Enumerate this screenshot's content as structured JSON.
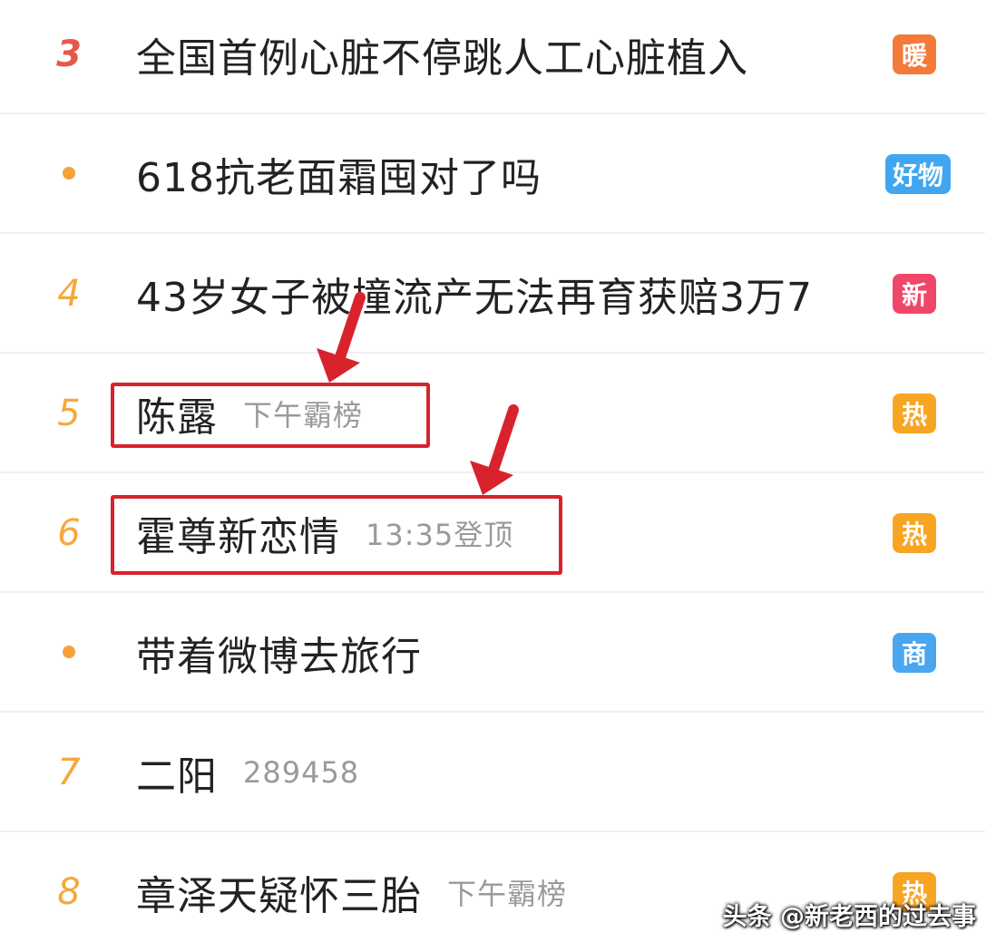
{
  "colors": {
    "warm": "#f47a3a",
    "goods": "#41a6f0",
    "new": "#f0466a",
    "hot": "#f8a524",
    "shop": "#4aa6ef",
    "highlight": "#d9232c",
    "rank_top": "#e8584a",
    "rank": "#f4a93c"
  },
  "rows": [
    {
      "rank": "3",
      "marker": "number-top",
      "title": "全国首例心脏不停跳人工心脏植入",
      "sub": "",
      "badge": "暖",
      "badge_type": "warm"
    },
    {
      "rank": "",
      "marker": "dot",
      "title": "618抗老面霜囤对了吗",
      "sub": "",
      "badge": "好物",
      "badge_type": "goods"
    },
    {
      "rank": "4",
      "marker": "number",
      "title": "43岁女子被撞流产无法再育获赔3万7",
      "sub": "",
      "badge": "新",
      "badge_type": "new"
    },
    {
      "rank": "5",
      "marker": "number",
      "title": "陈露",
      "sub": "下午霸榜",
      "badge": "热",
      "badge_type": "hot"
    },
    {
      "rank": "6",
      "marker": "number",
      "title": "霍尊新恋情",
      "sub": "13:35登顶",
      "badge": "热",
      "badge_type": "hot"
    },
    {
      "rank": "",
      "marker": "dot",
      "title": "带着微博去旅行",
      "sub": "",
      "badge": "商",
      "badge_type": "shop"
    },
    {
      "rank": "7",
      "marker": "number",
      "title": "二阳",
      "sub": "289458",
      "badge": "",
      "badge_type": ""
    },
    {
      "rank": "8",
      "marker": "number",
      "title": "章泽天疑怀三胎",
      "sub": "下午霸榜",
      "badge": "热",
      "badge_type": "hot"
    }
  ],
  "watermark": "头条 @新老西的过去事"
}
